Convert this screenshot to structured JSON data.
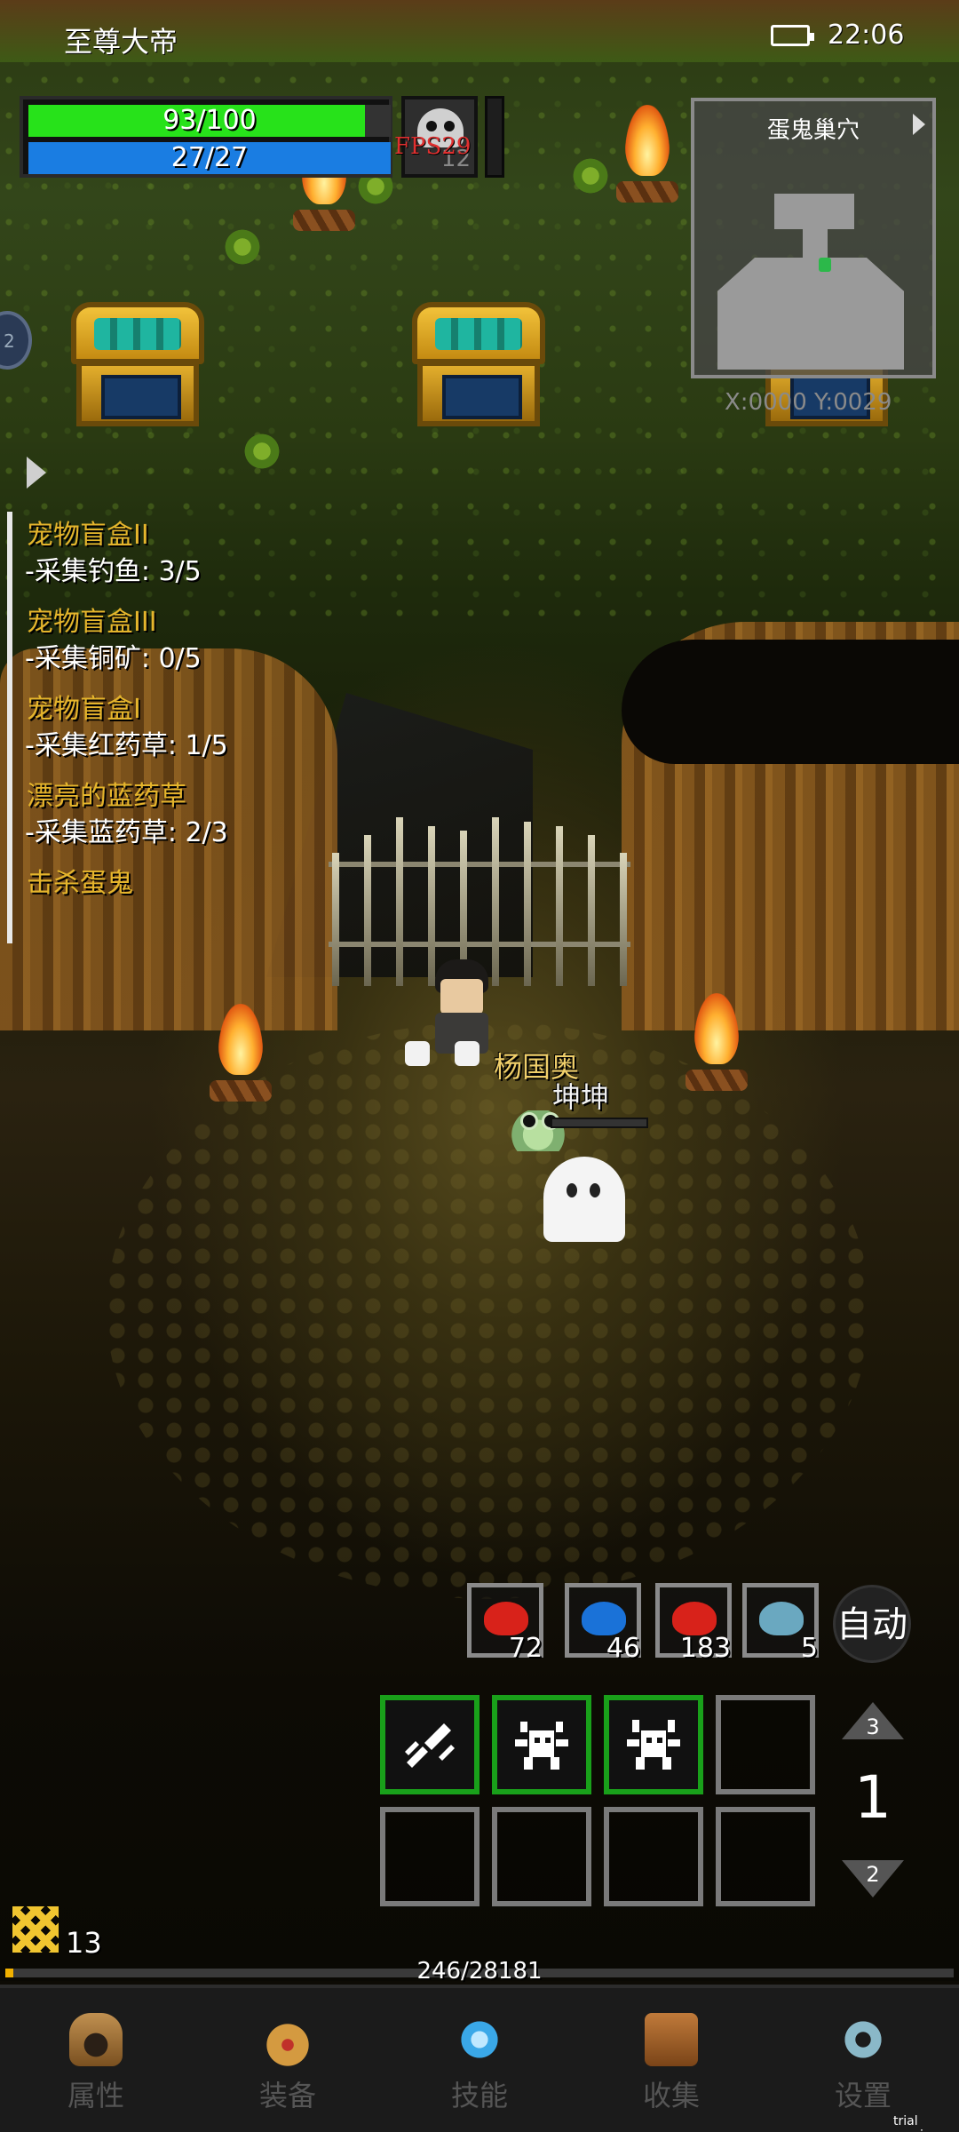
{
  "status_bar": {
    "app_title": "至尊大帝",
    "time": "22:06",
    "battery_icon": "battery-icon"
  },
  "player_stats": {
    "hp": "93/100",
    "hp_fraction": 0.93,
    "mp": "27/27",
    "mp_fraction": 1.0,
    "fps": "FPS29",
    "skull_count": "12",
    "hp_color": "#27e21a",
    "mp_color": "#1a7de2"
  },
  "minimap": {
    "title": "蛋鬼巢穴",
    "coordinates": "X:0000 Y:0029"
  },
  "left_orb": {
    "text": "2"
  },
  "quests": [
    {
      "title": "宠物盲盒II",
      "task": "-采集钓鱼: 3/5"
    },
    {
      "title": "宠物盲盒III",
      "task": "-采集铜矿: 0/5"
    },
    {
      "title": "宠物盲盒I",
      "task": "-采集红药草: 1/5"
    },
    {
      "title": "漂亮的蓝药草",
      "task": "-采集蓝药草: 2/3"
    },
    {
      "title": "击杀蛋鬼",
      "task": ""
    }
  ],
  "characters": {
    "player_name": "杨国奥",
    "pet_name": "坤坤"
  },
  "consumables": [
    {
      "icon": "red-meat-icon",
      "count": "72",
      "color": "#d8221a"
    },
    {
      "icon": "blue-meat-icon",
      "count": "46",
      "color": "#1a72d8"
    },
    {
      "icon": "red-meat-icon",
      "count": "183",
      "color": "#d8221a"
    },
    {
      "icon": "fish-icon",
      "count": "5",
      "color": "#6aa8c0"
    }
  ],
  "auto_button": "自动",
  "skill_page": {
    "current": "1",
    "up": "3",
    "down": "2"
  },
  "skills": [
    {
      "icon": "slash-icon",
      "active": true
    },
    {
      "icon": "monster-icon",
      "active": true
    },
    {
      "icon": "monster-icon",
      "active": true
    },
    {
      "icon": "",
      "active": false
    },
    {
      "icon": "",
      "active": false
    },
    {
      "icon": "",
      "active": false
    },
    {
      "icon": "",
      "active": false
    },
    {
      "icon": "",
      "active": false
    }
  ],
  "level": {
    "value": "13",
    "xp_text": "246/28181",
    "xp_fraction": 0.0087
  },
  "bottom_nav": [
    {
      "label": "属性",
      "icon": "helmet-icon"
    },
    {
      "label": "装备",
      "icon": "bag-icon"
    },
    {
      "label": "技能",
      "icon": "gem-icon"
    },
    {
      "label": "收集",
      "icon": "book-icon"
    },
    {
      "label": "设置",
      "icon": "gear-icon"
    }
  ],
  "watermark": "trial version"
}
